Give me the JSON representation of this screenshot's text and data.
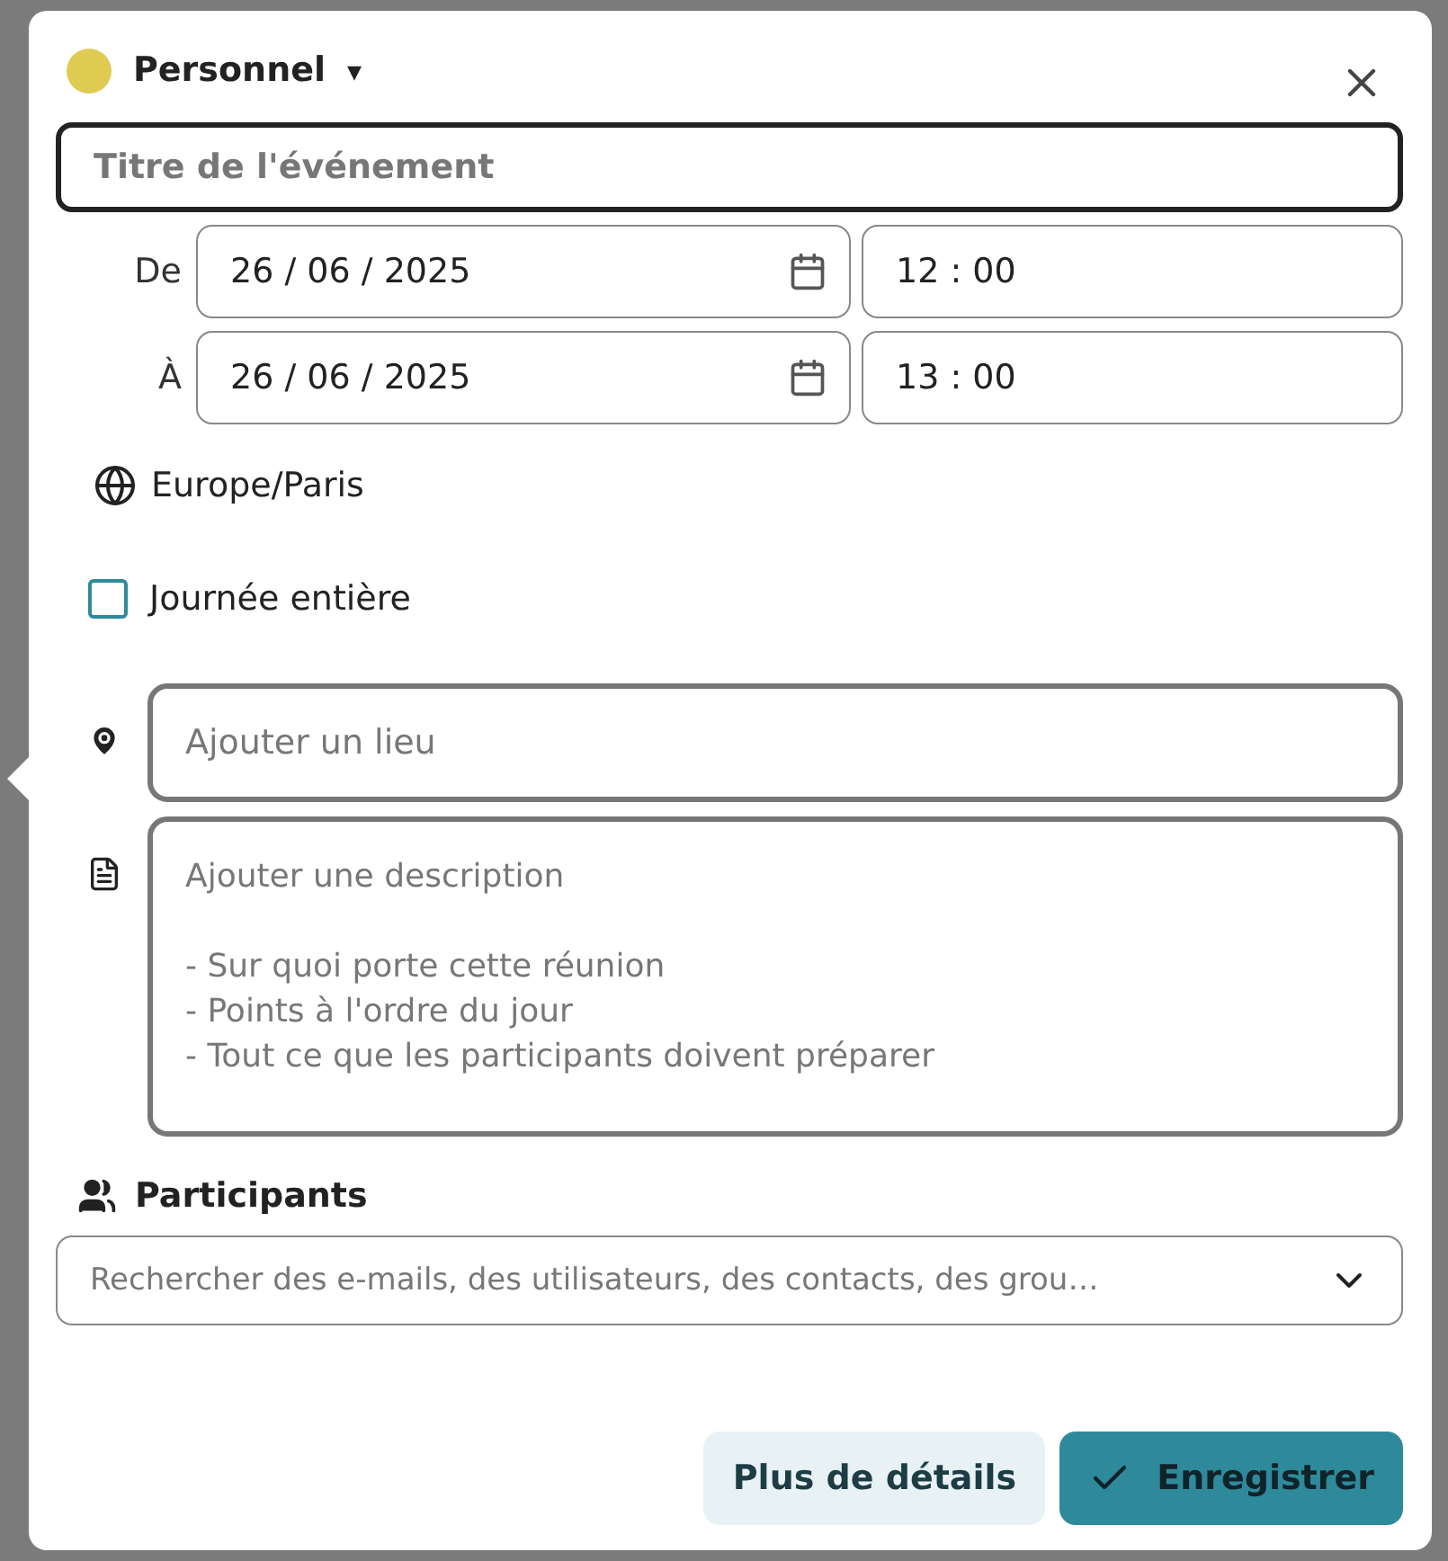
{
  "calendar": {
    "name": "Personnel",
    "color": "#e0cb52",
    "caret": "▾"
  },
  "title_field": {
    "placeholder": "Titre de l'événement"
  },
  "from": {
    "label": "De",
    "date": "26 / 06 / 2025",
    "time": "12 : 00"
  },
  "to": {
    "label": "À",
    "date": "26 / 06 / 2025",
    "time": "13 : 00"
  },
  "timezone": "Europe/Paris",
  "all_day": {
    "label": "Journée entière",
    "checked": false
  },
  "location": {
    "placeholder": "Ajouter un lieu"
  },
  "description": {
    "placeholder": "Ajouter une description\n\n- Sur quoi porte cette réunion\n- Points à l'ordre du jour\n- Tout ce que les participants doivent préparer"
  },
  "participants": {
    "heading": "Participants",
    "placeholder": "Rechercher des e-mails, des utilisateurs, des contacts, des grou…"
  },
  "buttons": [
    {
      "label": "Plus de détails",
      "kind": "secondary"
    },
    {
      "label": "Enregistrer",
      "kind": "primary"
    }
  ]
}
